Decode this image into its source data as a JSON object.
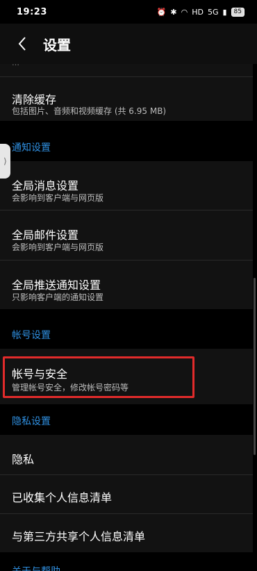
{
  "status": {
    "time": "19:23",
    "battery": "85",
    "network": "5G"
  },
  "header": {
    "title": "设置"
  },
  "items": {
    "cut_top_text": "…",
    "clear_cache_title": "清除缓存",
    "clear_cache_sub": "包括图片、音频和视频缓存 (共 6.95 MB)",
    "notify_section": "通知设置",
    "global_msg_title": "全局消息设置",
    "global_msg_sub": "会影响到客户端与网页版",
    "global_mail_title": "全局邮件设置",
    "global_mail_sub": "会影响到客户端与网页版",
    "global_push_title": "全局推送通知设置",
    "global_push_sub": "只影响客户端的通知设置",
    "account_section": "帐号设置",
    "account_security_title": "帐号与安全",
    "account_security_sub": "管理帐号安全，修改帐号密码等",
    "privacy_section": "隐私设置",
    "privacy_title": "隐私",
    "collected_info_title": "已收集个人信息清单",
    "third_party_title": "与第三方共享个人信息清单",
    "about_section": "关于与帮助"
  },
  "colors": {
    "accent": "#2f8fe0",
    "highlight": "#e22b2b"
  }
}
